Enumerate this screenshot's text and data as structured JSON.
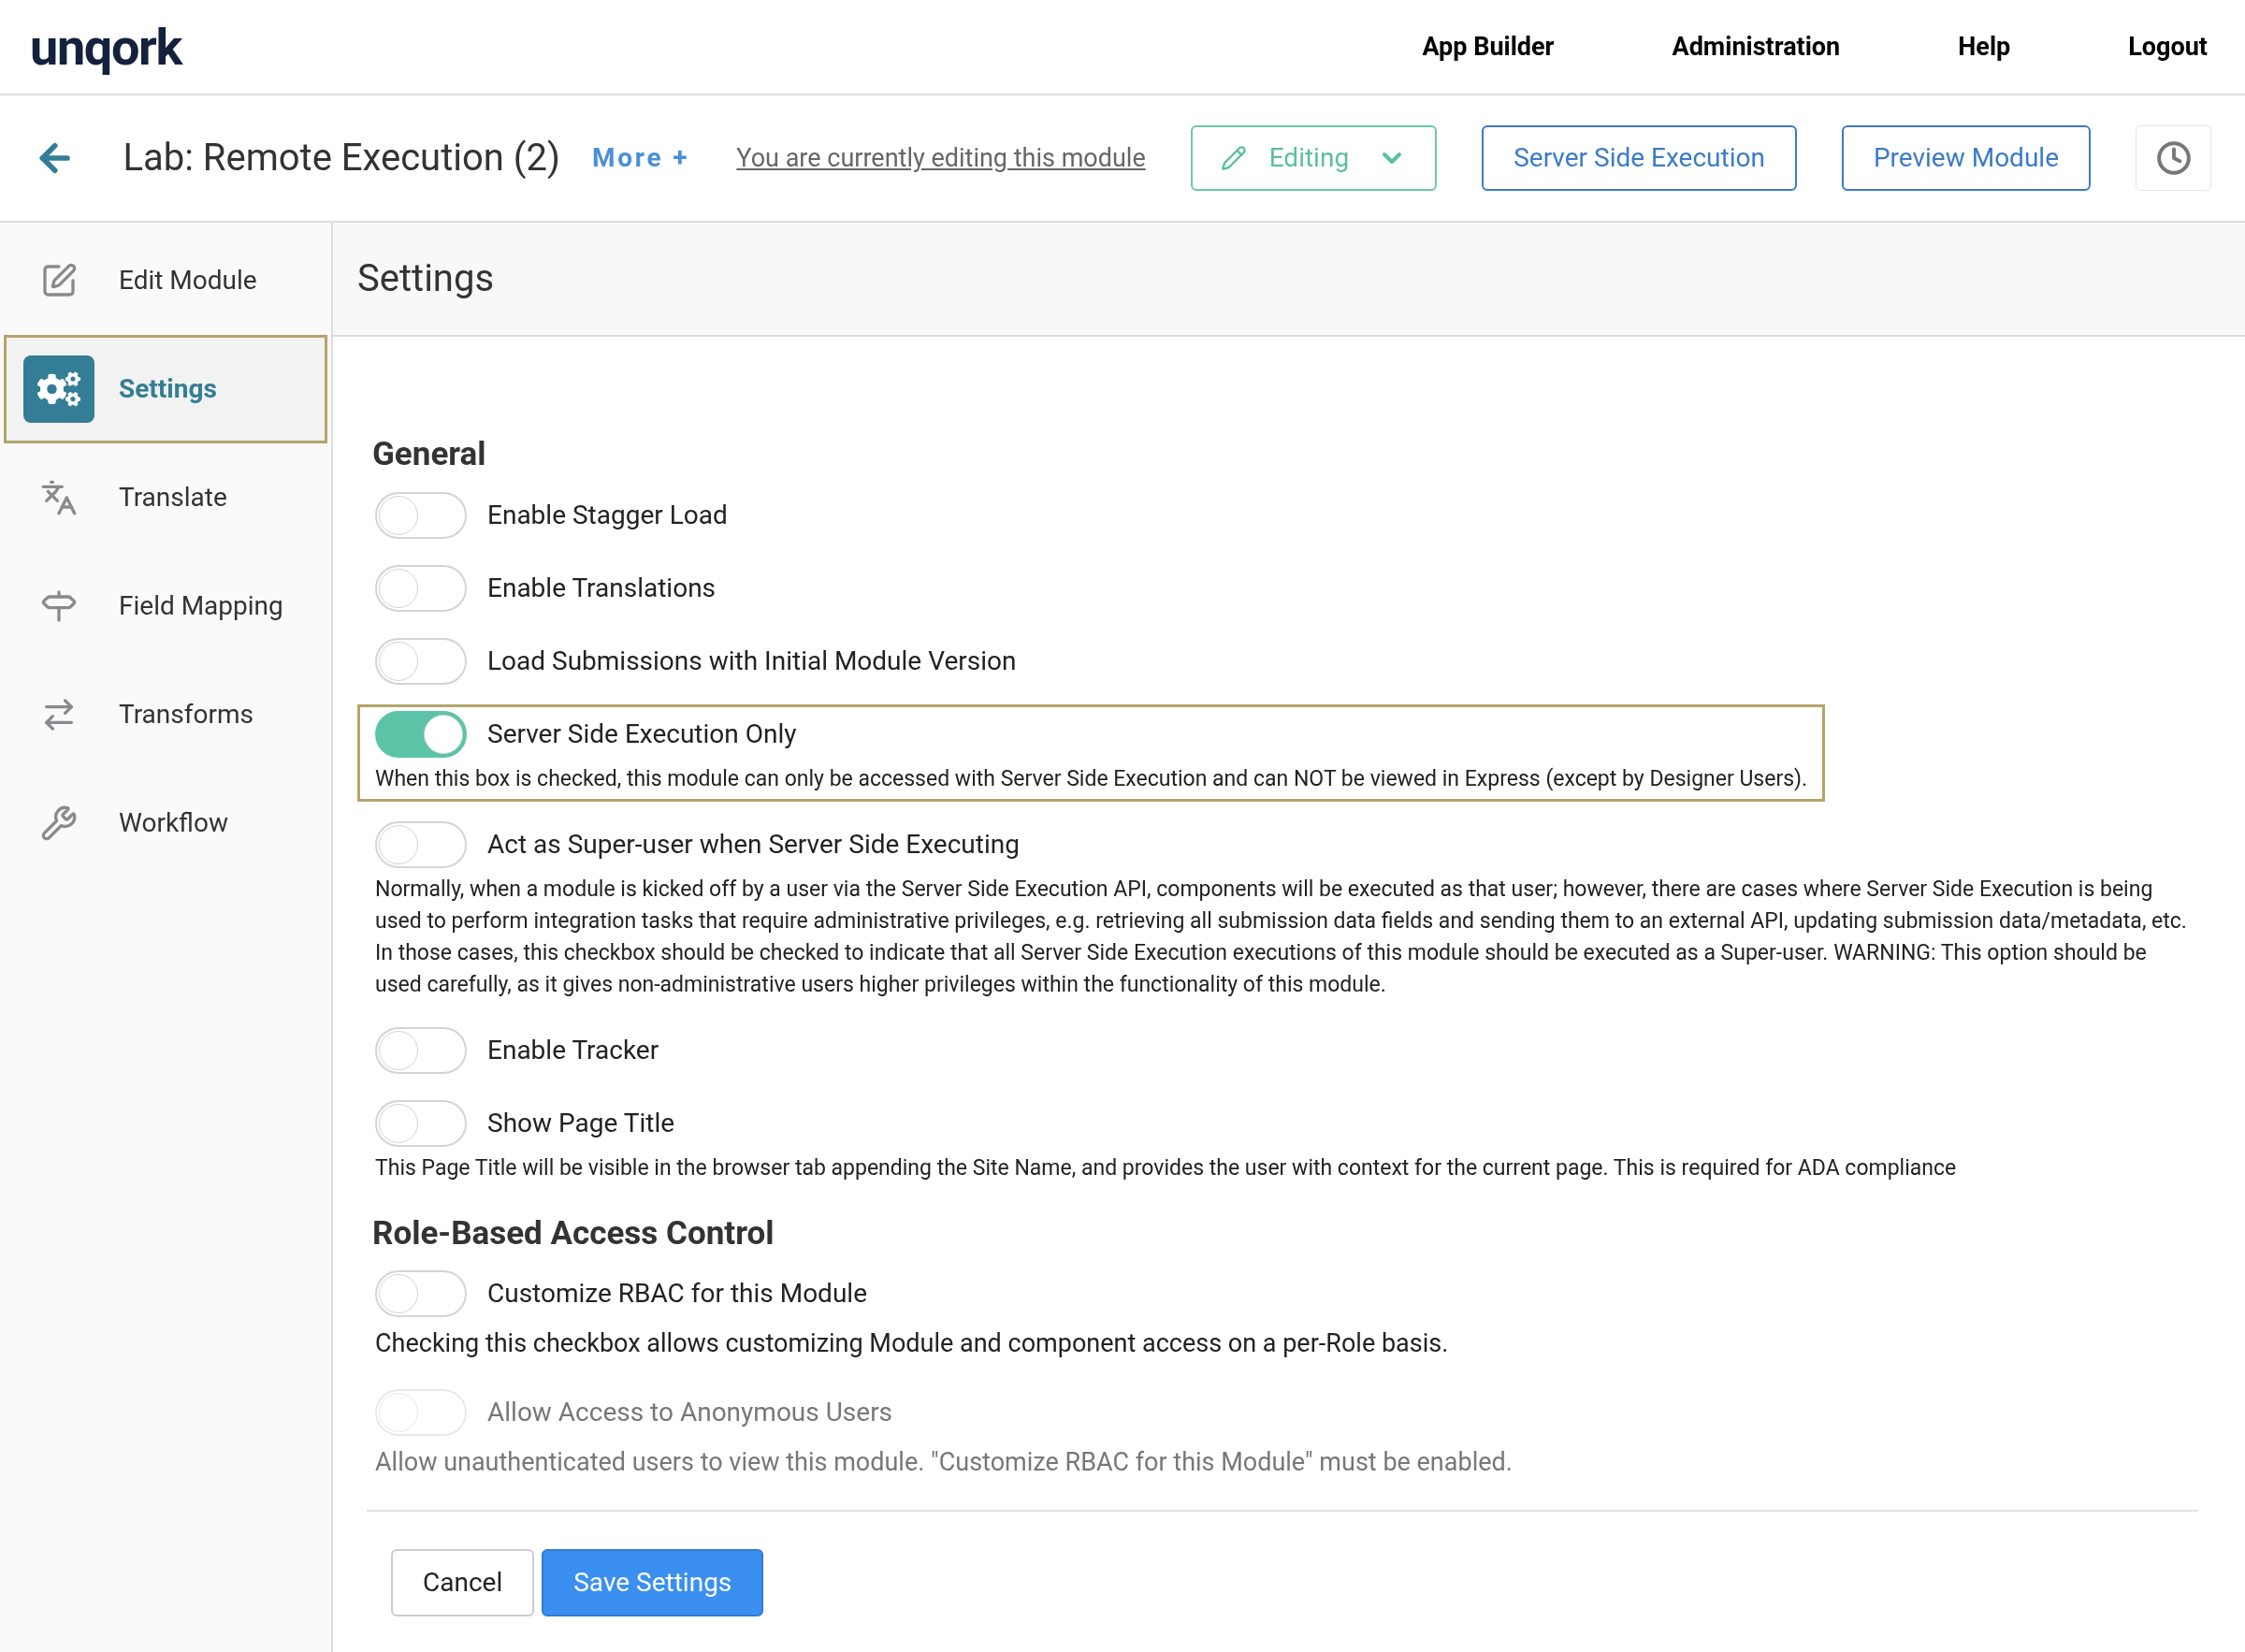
{
  "brand": "unqork",
  "top_nav": [
    "App Builder",
    "Administration",
    "Help",
    "Logout"
  ],
  "module_bar": {
    "title": "Lab: Remote Execution (2)",
    "more": "More +",
    "editing_notice": "You are currently editing this module",
    "mode": "Editing",
    "buttons": [
      "Server Side Execution",
      "Preview Module"
    ]
  },
  "sidebar": {
    "items": [
      {
        "label": "Edit Module",
        "kind": "edit",
        "selected": false
      },
      {
        "label": "Settings",
        "kind": "settings",
        "selected": true
      },
      {
        "label": "Translate",
        "kind": "translate",
        "selected": false
      },
      {
        "label": "Field Mapping",
        "kind": "mapping",
        "selected": false
      },
      {
        "label": "Transforms",
        "kind": "transforms",
        "selected": false
      },
      {
        "label": "Workflow",
        "kind": "workflow",
        "selected": false
      }
    ]
  },
  "page_title": "Settings",
  "sections": [
    {
      "heading": "General",
      "options": [
        {
          "label": "Enable Stagger Load",
          "on": false,
          "disabled": false,
          "focused": false
        },
        {
          "label": "Enable Translations",
          "on": false,
          "disabled": false,
          "focused": false
        },
        {
          "label": "Load Submissions with Initial Module Version",
          "on": false,
          "disabled": false,
          "focused": false
        },
        {
          "label": "Server Side Execution Only",
          "on": true,
          "disabled": false,
          "focused": true,
          "description": "When this box is checked, this module can only be accessed with Server Side Execution and can NOT be viewed in Express (except by Designer Users)."
        },
        {
          "label": "Act as Super-user when Server Side Executing",
          "on": false,
          "disabled": false,
          "focused": false,
          "description": "Normally, when a module is kicked off by a user via the Server Side Execution API, components will be executed as that user; however, there are cases where Server Side Execution is being used to perform integration tasks that require administrative privileges, e.g. retrieving all submission data fields and sending them to an external API, updating submission data/metadata, etc. In those cases, this checkbox should be checked to indicate that all Server Side Execution executions of this module should be executed as a Super-user. WARNING: This option should be used carefully, as it gives non-administrative users higher privileges within the functionality of this module."
        },
        {
          "label": "Enable Tracker",
          "on": false,
          "disabled": false,
          "focused": false
        },
        {
          "label": "Show Page Title",
          "on": false,
          "disabled": false,
          "focused": false,
          "description": "This Page Title will be visible in the browser tab appending the Site Name, and provides the user with context for the current page. This is required for ADA compliance"
        }
      ]
    },
    {
      "heading": "Role-Based Access Control",
      "options": [
        {
          "label": "Customize RBAC for this Module",
          "on": false,
          "disabled": false,
          "focused": false,
          "description": "Checking this checkbox allows customizing Module and component access on a per-Role basis.",
          "large": true
        },
        {
          "label": "Allow Access to Anonymous Users",
          "on": false,
          "disabled": true,
          "focused": false,
          "description": "Allow unauthenticated users to view this module. \"Customize RBAC for this Module\" must be enabled.",
          "large": true
        }
      ]
    }
  ],
  "actions": {
    "cancel": "Cancel",
    "save": "Save Settings"
  }
}
